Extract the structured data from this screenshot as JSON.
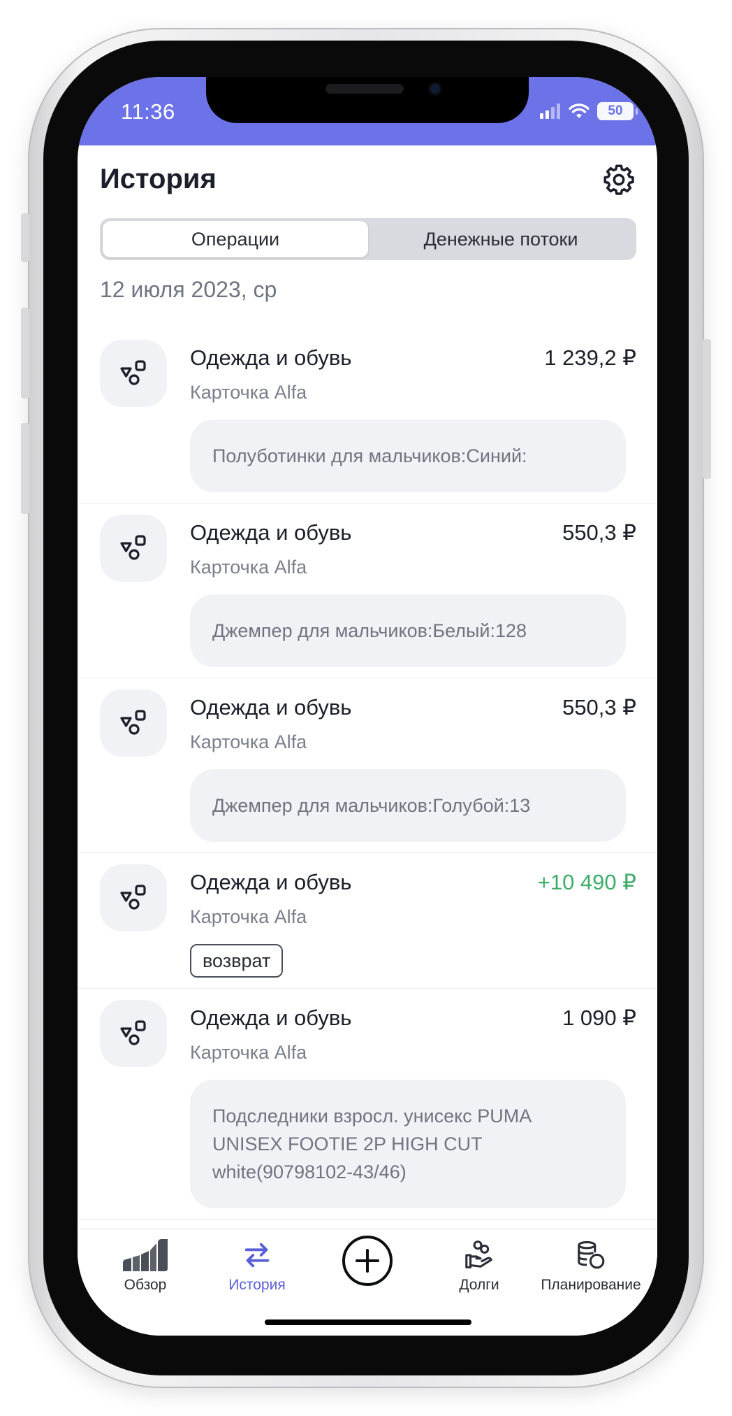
{
  "status_bar": {
    "time": "11:36",
    "battery": "50"
  },
  "header": {
    "title": "История",
    "settings_icon": "gear-icon"
  },
  "segments": {
    "operations": "Операции",
    "cash_flows": "Денежные потоки",
    "selected": "operations"
  },
  "date_group": "12 июля 2023, ср",
  "transactions": [
    {
      "category": "Одежда и обувь",
      "account": "Карточка Alfa",
      "amount": "1 239,2 ₽",
      "note": "Полуботинки для мальчиков:Синий:"
    },
    {
      "category": "Одежда и обувь",
      "account": "Карточка Alfa",
      "amount": "550,3 ₽",
      "note": "Джемпер для мальчиков:Белый:128"
    },
    {
      "category": "Одежда и обувь",
      "account": "Карточка Alfa",
      "amount": "550,3 ₽",
      "note": "Джемпер для мальчиков:Голубой:13"
    },
    {
      "category": "Одежда и обувь",
      "account": "Карточка Alfa",
      "amount": "+10 490 ₽",
      "tag": "возврат"
    },
    {
      "category": "Одежда и обувь",
      "account": "Карточка Alfa",
      "amount": "1 090 ₽",
      "note": "Подследники взросл. унисекс PUMA UNISEX FOOTIE 2P HIGH CUT white(90798102-43/46)"
    }
  ],
  "tabbar": {
    "overview": "Обзор",
    "history": "История",
    "add_icon": "plus-circle-icon",
    "debts": "Долги",
    "planning": "Планирование",
    "active": "history"
  },
  "colors": {
    "accent": "#6c72e8",
    "positive": "#3fad6a",
    "active_tab": "#5a5fd8"
  }
}
